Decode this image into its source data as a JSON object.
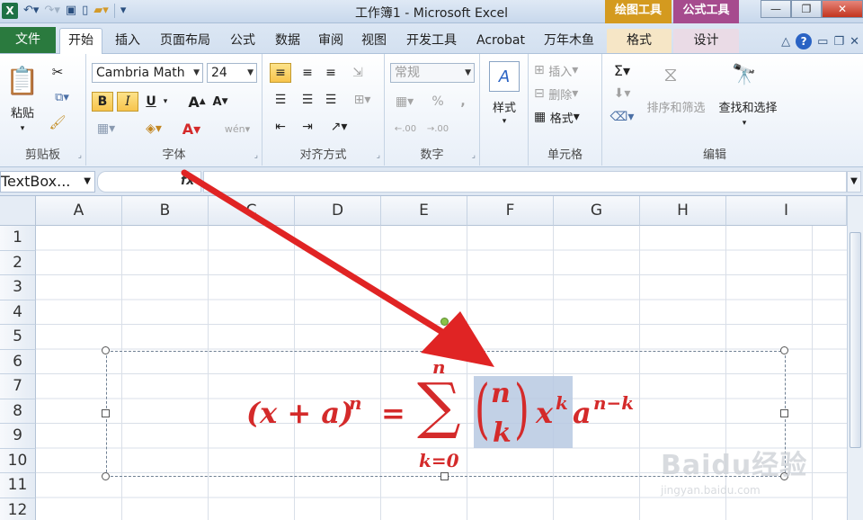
{
  "window": {
    "title": "工作簿1 - Microsoft Excel"
  },
  "qat": {
    "app_icon": "X"
  },
  "contextual": {
    "drawing_tools": "绘图工具",
    "equation_tools": "公式工具"
  },
  "tabs": [
    "文件",
    "开始",
    "插入",
    "页面布局",
    "公式",
    "数据",
    "审阅",
    "视图",
    "开发工具",
    "Acrobat",
    "万年木鱼",
    "格式",
    "设计"
  ],
  "ribbon": {
    "clipboard": {
      "paste": "粘贴",
      "label": "剪贴板"
    },
    "font": {
      "name": "Cambria Math",
      "size": "24",
      "bold": "B",
      "italic": "I",
      "underline": "U",
      "label": "字体",
      "grow": "A",
      "shrink": "A",
      "wen": "wén"
    },
    "alignment": {
      "label": "对齐方式"
    },
    "number": {
      "format": "常规",
      "percent": "%",
      "comma": ",",
      "label": "数字",
      "inc": ".00",
      "dec": ".00"
    },
    "styles": {
      "label": "样式"
    },
    "cells": {
      "insert": "插入",
      "delete": "删除",
      "format": "格式",
      "label": "单元格"
    },
    "editing": {
      "sigma": "Σ",
      "sort": "排序和筛选",
      "find": "查找和选择",
      "label": "编辑"
    }
  },
  "formula_bar": {
    "name_box": "TextBox...",
    "fx": "fx"
  },
  "columns": [
    "A",
    "B",
    "C",
    "D",
    "E",
    "F",
    "G",
    "H",
    "I"
  ],
  "rows": [
    "1",
    "2",
    "3",
    "4",
    "5",
    "6",
    "7",
    "8",
    "9",
    "10",
    "11",
    "12"
  ],
  "equation": {
    "lhs": "(x + a)",
    "lhs_exp": "n",
    "equals": "=",
    "sum": "∑",
    "upper": "n",
    "lower": "k=0",
    "binom_top": "n",
    "binom_bottom": "k",
    "x": "x",
    "x_exp": "k",
    "a": "a",
    "a_exp": "n−k"
  },
  "watermark": {
    "line1": "Baidu经验",
    "line2": "jingyan.baidu.com"
  },
  "colors": {
    "equation": "#d42a2a",
    "arrow": "#e02424",
    "file_tab": "#2a7a3e"
  }
}
